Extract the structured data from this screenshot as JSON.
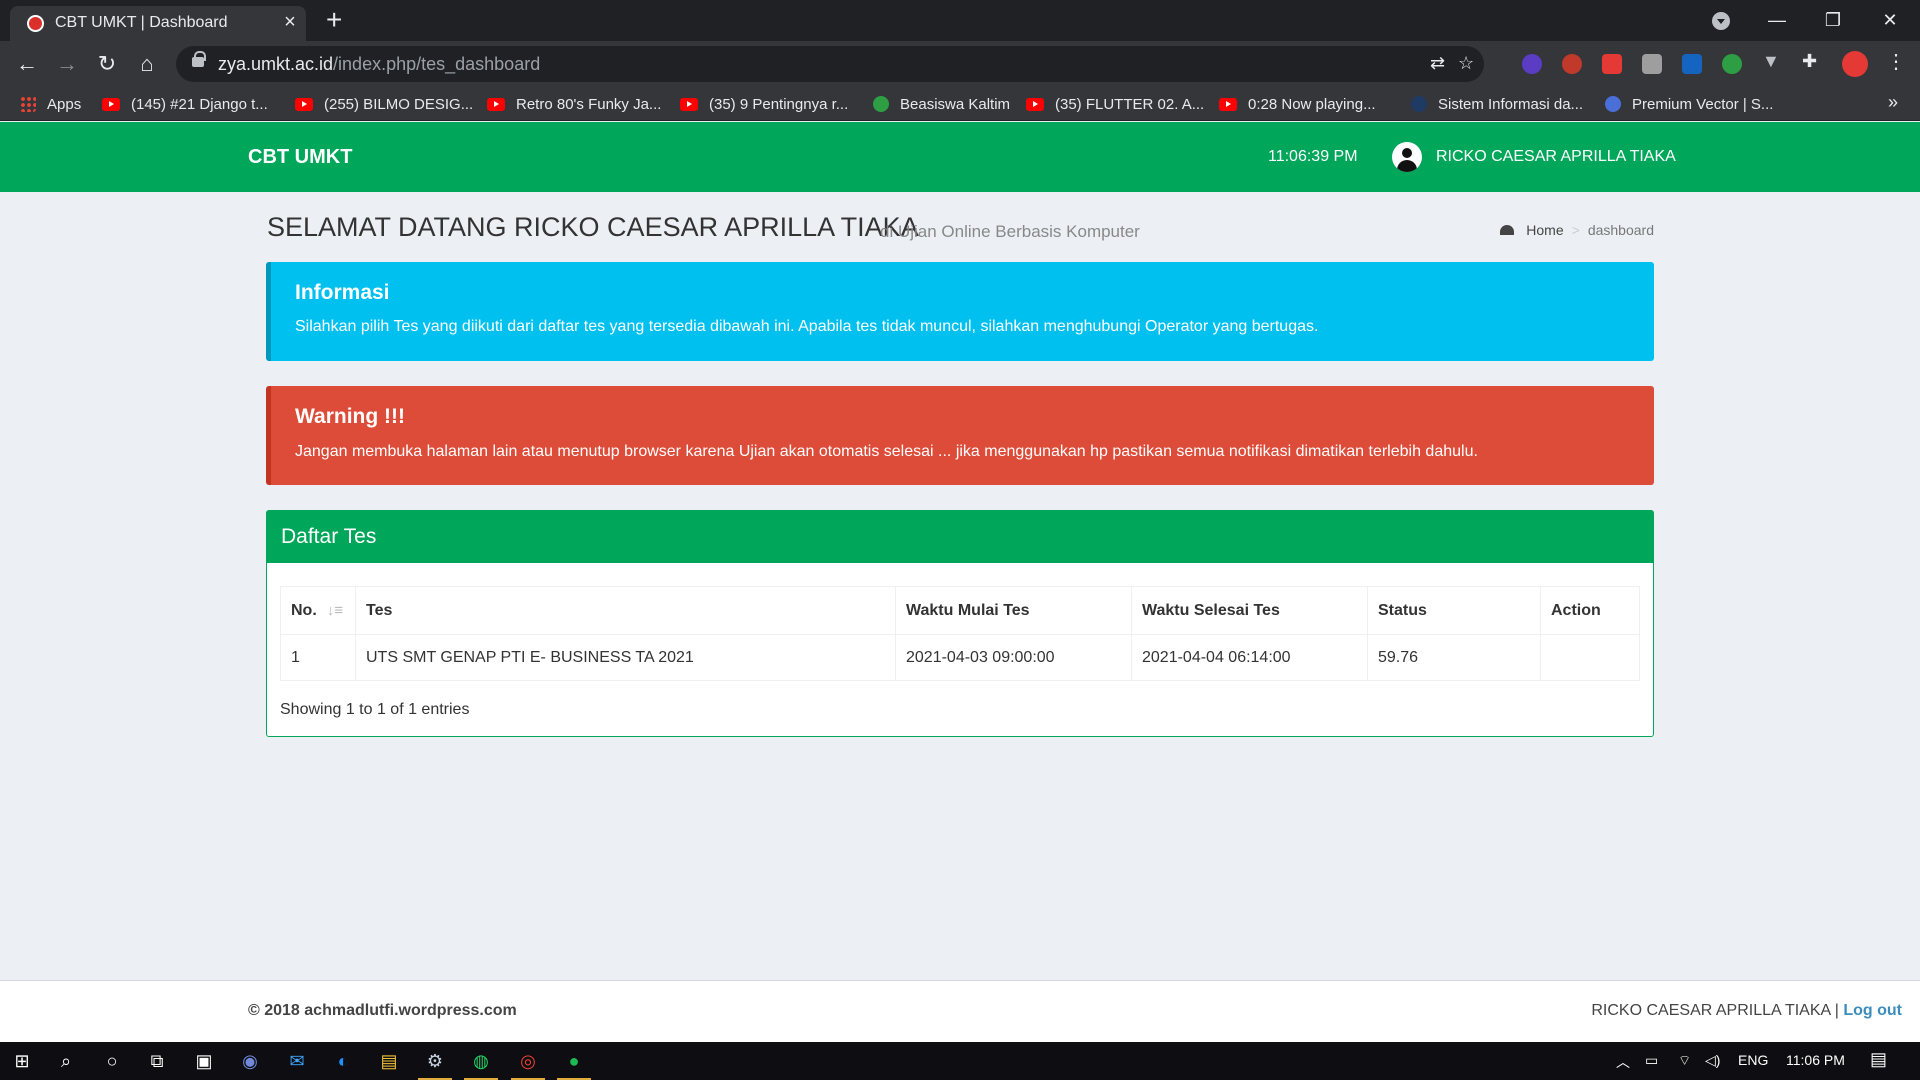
{
  "browser": {
    "tab_title": "CBT UMKT | Dashboard",
    "url_domain": "zya.umkt.ac.id",
    "url_path": "/index.php/tes_dashboard",
    "bookmarks": [
      {
        "label": "Apps",
        "icon": "apps-grid-icon"
      },
      {
        "label": "(145) #21 Django t...",
        "icon": "youtube-icon"
      },
      {
        "label": "(255) BILMO DESIG...",
        "icon": "youtube-icon"
      },
      {
        "label": "Retro 80's Funky Ja...",
        "icon": "youtube-icon"
      },
      {
        "label": "(35) 9 Pentingnya r...",
        "icon": "youtube-icon"
      },
      {
        "label": "Beasiswa Kaltim",
        "icon": "globe-icon"
      },
      {
        "label": "(35) FLUTTER 02. A...",
        "icon": "youtube-icon"
      },
      {
        "label": "0:28 Now playing...",
        "icon": "youtube-icon"
      },
      {
        "label": "Sistem Informasi da...",
        "icon": "site-icon"
      },
      {
        "label": "Premium Vector | S...",
        "icon": "freepik-icon"
      }
    ],
    "more_bookmarks": "»"
  },
  "header": {
    "brand": "CBT UMKT",
    "time": "11:06:39 PM",
    "user_name": "RICKO CAESAR APRILLA TIAKA",
    "accent_color": "#00a65a"
  },
  "page": {
    "title": "SELAMAT DATANG RICKO CAESAR APRILLA TIAKA",
    "subtitle": "di Ujian Online Berbasis Komputer",
    "breadcrumb": {
      "home": "Home",
      "separator": ">",
      "current": "dashboard"
    }
  },
  "info_callout": {
    "title": "Informasi",
    "text": "Silahkan pilih Tes yang diikuti dari daftar tes yang tersedia dibawah ini. Apabila tes tidak muncul, silahkan menghubungi Operator yang bertugas.",
    "color": "#00c0ef"
  },
  "warning_callout": {
    "title": "Warning !!!",
    "text": "Jangan membuka halaman lain atau menutup browser karena Ujian akan otomatis selesai ... jika menggunakan hp pastikan semua notifikasi dimatikan terlebih dahulu.",
    "color": "#dd4b39"
  },
  "tests_box": {
    "title": "Daftar Tes",
    "columns": [
      "No.",
      "Tes",
      "Waktu Mulai Tes",
      "Waktu Selesai Tes",
      "Status",
      "Action"
    ],
    "rows": [
      {
        "no": "1",
        "tes": "UTS SMT GENAP PTI E- BUSINESS TA 2021",
        "mulai": "2021-04-03 09:00:00",
        "selesai": "2021-04-04 06:14:00",
        "status": "59.76",
        "action": ""
      }
    ],
    "showing": "Showing 1 to 1 of 1 entries"
  },
  "footer": {
    "copyright": "© 2018 achmadlutfi.wordpress.com",
    "user": "RICKO CAESAR APRILLA TIAKA",
    "divider": "|",
    "logout": "Log out"
  },
  "taskbar": {
    "language": "ENG",
    "time": "11:06 PM"
  }
}
